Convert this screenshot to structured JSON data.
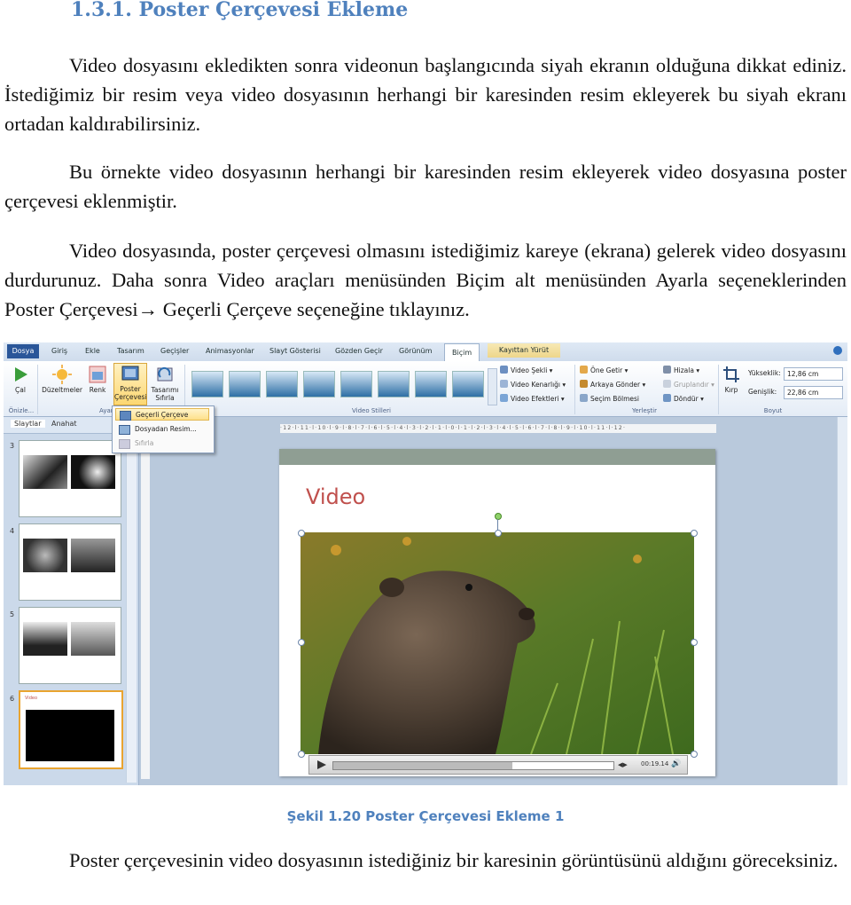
{
  "heading": "1.3.1. Poster Çerçevesi Ekleme",
  "paragraphs": [
    "Video dosyasını ekledikten sonra videonun başlangıcında siyah ekranın olduğuna dikkat ediniz. İstediğimiz bir resim veya video dosyasının herhangi bir karesinden resim ekleyerek bu siyah ekranı ortadan kaldırabilirsiniz.",
    "Bu örnekte video dosyasının herhangi bir karesinden resim ekleyerek video dosyasına poster çerçevesi eklenmiştir."
  ],
  "para3": {
    "part1": "Video dosyasında, poster çerçevesi olmasını istediğimiz kareye (ekrana) gelerek video dosyasını durdurunuz. Daha sonra Video araçları menüsünden Biçim alt menüsünden Ayarla seçeneklerinden Poster Çerçevesi",
    "arrow": "→",
    "part2": " Geçerli Çerçeve seçeneğine tıklayınız."
  },
  "caption": "Şekil 1.20 Poster Çerçevesi Ekleme 1",
  "closing": "Poster çerçevesinin video dosyasının istediğiniz bir karesinin görüntüsünü aldığını göreceksiniz.",
  "screenshot": {
    "tabs": [
      "Dosya",
      "Giriş",
      "Ekle",
      "Tasarım",
      "Geçişler",
      "Animasyonlar",
      "Slayt Gösterisi",
      "Gözden Geçir",
      "Görünüm",
      "Biçim",
      "Kayıttan Yürüt"
    ],
    "ribbon": {
      "cal": "Çal",
      "duzeltmeler": "Düzeltmeler",
      "renk": "Renk",
      "poster": "Poster Çerçevesi",
      "tasarimi": "Tasarımı Sıfırla",
      "group_onizle": "Önizle...",
      "group_ayarla": "Ayarla",
      "group_video_stilleri": "Video Stilleri",
      "group_yerlestir": "Yerleştir",
      "group_boyut": "Boyut",
      "video_sekli": "Video Şekli",
      "video_kenarligi": "Video Kenarlığı",
      "video_efektleri": "Video Efektleri",
      "one_getir": "Öne Getir",
      "arkaya_gonder": "Arkaya Gönder",
      "secim_bolmesi": "Seçim Bölmesi",
      "hizala": "Hizala",
      "grupla": "Gruplandır",
      "dondur": "Döndür",
      "kirp": "Kırp",
      "yukseklik_label": "Yükseklik:",
      "yukseklik": "12,86 cm",
      "genislik_label": "Genişlik:",
      "genislik": "22,86 cm"
    },
    "dropdown": [
      "Geçerli Çerçeve",
      "Dosyadan Resim...",
      "Sıfırla"
    ],
    "pane_tabs": [
      "Slaytlar",
      "Anahat"
    ],
    "slide_numbers": [
      "3",
      "4",
      "5",
      "6"
    ],
    "slide6_title": "Video",
    "slide_title": "Video",
    "video_time": "00:19.14",
    "ruler": "·12·l·11·l·10·l·9·l·8·l·7·l·6·l·5·l·4·l·3·l·2·l·1·l·0·l·1·l·2·l·3·l·4·l·5·l·6·l·7·l·8·l·9·l·10·l·11·l·12·"
  },
  "colors": {
    "heading": "#4f81bd",
    "file_tab": "#2a5699",
    "slide_title": "#c0504d",
    "selection": "#e9a430"
  }
}
